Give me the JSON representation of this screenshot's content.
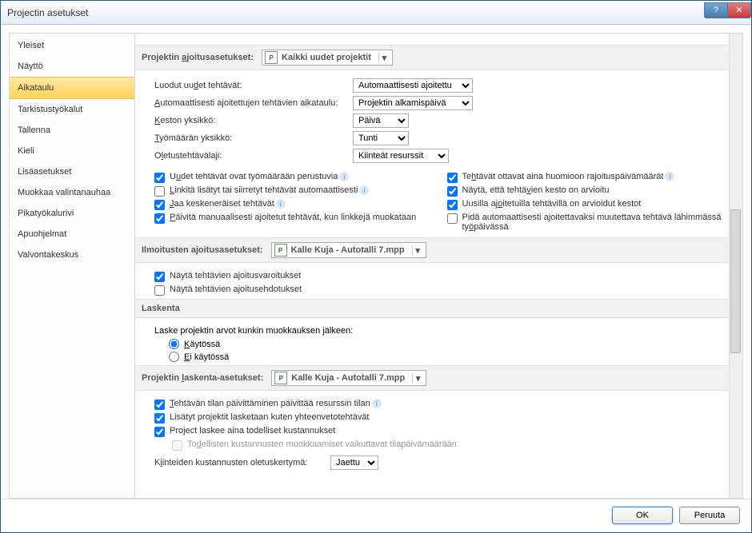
{
  "title": "Projectin asetukset",
  "sidebar": {
    "items": [
      {
        "label": "Yleiset"
      },
      {
        "label": "Näyttö"
      },
      {
        "label": "Aikataulu"
      },
      {
        "label": "Tarkistustyökalut"
      },
      {
        "label": "Tallenna"
      },
      {
        "label": "Kieli"
      },
      {
        "label": "Lisäasetukset"
      },
      {
        "label": "Muokkaa valintanauhaa"
      },
      {
        "label": "Pikatyökalurivi"
      },
      {
        "label": "Apuohjelmat"
      },
      {
        "label": "Valvontakeskus"
      }
    ]
  },
  "sec1": {
    "title": "Projektin ajoitusasetukset:",
    "file": "Kaikki uudet projektit"
  },
  "r1": {
    "lbl": "Luodut uudet tehtävät:",
    "val": "Automaattisesti ajoitettu"
  },
  "r2": {
    "lbl": "Automaattisesti ajoitettujen tehtävien aikataulu:",
    "val": "Projektin alkamispäivä"
  },
  "r3": {
    "lbl": "Keston yksikkö:",
    "val": "Päivä"
  },
  "r4": {
    "lbl": "Työmäärän yksikkö:",
    "val": "Tunti"
  },
  "r5": {
    "lbl": "Oletustehtävälaji:",
    "val": "Kiinteät resurssit"
  },
  "chkL": [
    {
      "t": "Uudet tehtävät ovat työmäärään perustuvia",
      "c": true,
      "i": true
    },
    {
      "t": "Linkitä lisätyt tai siirretyt tehtävät automaattisesti",
      "c": false,
      "i": true
    },
    {
      "t": "Jaa keskeneräiset tehtävät",
      "c": true,
      "i": true
    },
    {
      "t": "Päivitä manuaalisesti ajoitetut tehtävät, kun linkkejä muokataan",
      "c": true,
      "i": false
    }
  ],
  "chkR": [
    {
      "t": "Tehtävät ottavat aina huomioon rajoituspäivämäärät",
      "c": true,
      "i": true
    },
    {
      "t": "Näytä, että tehtävien kesto on arvioitu",
      "c": true,
      "i": false
    },
    {
      "t": "Uusilla ajoitetuilla tehtävillä on arvioidut kestot",
      "c": true,
      "i": false
    },
    {
      "t": "Pidä automaattisesti ajoitettavaksi muutettava tehtävä lähimmässä työpäivässä",
      "c": false,
      "i": false
    }
  ],
  "sec2": {
    "title": "Ilmoitusten ajoitusasetukset:",
    "file": "Kalle Kuja - Autotalli 7.mpp"
  },
  "chk2": [
    {
      "t": "Näytä tehtävien ajoitusvaroitukset",
      "c": true
    },
    {
      "t": "Näytä tehtävien ajoitusehdotukset",
      "c": false
    }
  ],
  "sec3": {
    "title": "Laskenta"
  },
  "calc": {
    "lbl": "Laske projektin arvot kunkin muokkauksen jälkeen:",
    "on": "Käytössä",
    "off": "Ei käytössä"
  },
  "sec4": {
    "title": "Projektin laskenta-asetukset:",
    "file": "Kalle Kuja - Autotalli 7.mpp"
  },
  "chk4": [
    {
      "t": "Tehtävän tilan päivittäminen päivittää resurssin tilan",
      "c": true,
      "i": true
    },
    {
      "t": "Lisätyt projektit lasketaan kuten yhteenvetotehtävät",
      "c": true,
      "i": false
    },
    {
      "t": "Project laskee aina todelliset kustannukset",
      "c": true,
      "i": false
    }
  ],
  "chk4sub": {
    "t": "Todellisten kustannusten muokkaamiset vaikuttavat tilapäivämäärään",
    "c": false
  },
  "r6": {
    "lbl": "Kiinteiden kustannusten oletuskertymä:",
    "val": "Jaettu"
  },
  "footer": {
    "ok": "OK",
    "cancel": "Peruuta"
  }
}
